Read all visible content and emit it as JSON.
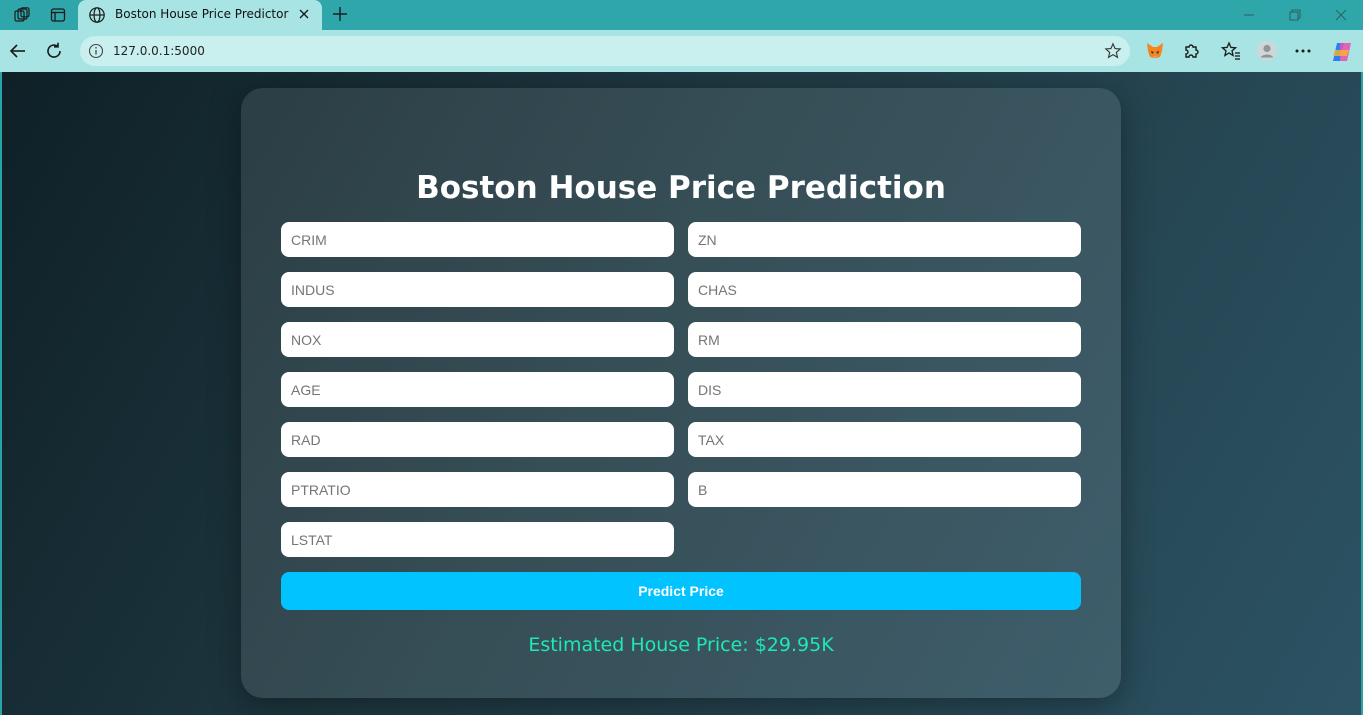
{
  "browser": {
    "tab_title": "Boston House Price Predictor",
    "url": "127.0.0.1:5000"
  },
  "icons": [
    "workspaces-icon",
    "tab-actions-icon",
    "globe-icon",
    "close-icon",
    "new-tab-icon",
    "minimize-icon",
    "restore-icon",
    "window-close-icon",
    "back-icon",
    "refresh-icon",
    "info-icon",
    "star-icon",
    "metamask-icon",
    "extensions-icon",
    "favorites-icon",
    "profile-icon",
    "more-icon",
    "copilot-icon"
  ],
  "page": {
    "title": "Boston House Price Prediction",
    "fields": [
      {
        "placeholder": "CRIM"
      },
      {
        "placeholder": "ZN"
      },
      {
        "placeholder": "INDUS"
      },
      {
        "placeholder": "CHAS"
      },
      {
        "placeholder": "NOX"
      },
      {
        "placeholder": "RM"
      },
      {
        "placeholder": "AGE"
      },
      {
        "placeholder": "DIS"
      },
      {
        "placeholder": "RAD"
      },
      {
        "placeholder": "TAX"
      },
      {
        "placeholder": "PTRATIO"
      },
      {
        "placeholder": "B"
      },
      {
        "placeholder": "LSTAT"
      }
    ],
    "predict_label": "Predict Price",
    "result": "Estimated House Price: $29.95K"
  },
  "colors": {
    "button": "#00c3ff",
    "result": "#1de9b6"
  }
}
